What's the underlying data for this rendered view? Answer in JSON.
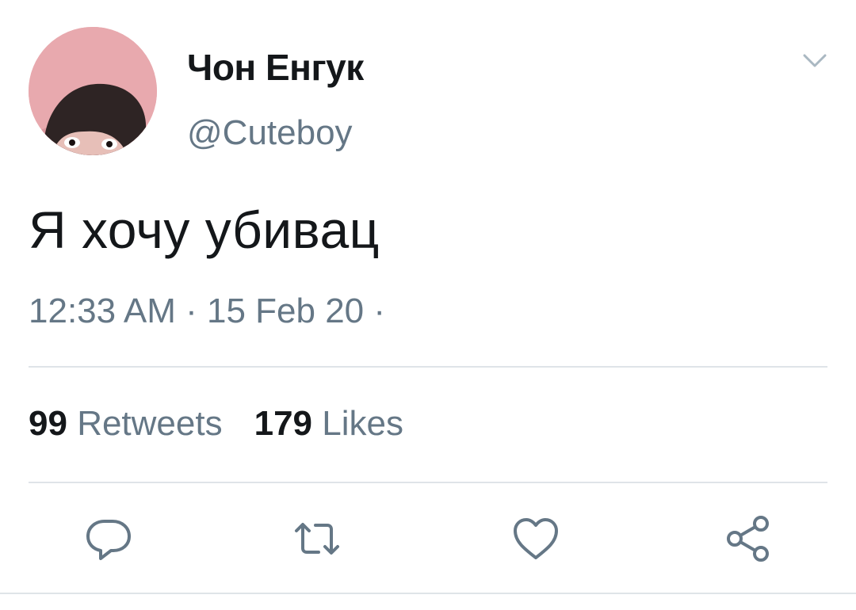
{
  "user": {
    "display_name": "Чон Енгук",
    "handle": "@Cuteboy",
    "avatar_icon": "profile-photo"
  },
  "tweet": {
    "text": "Я хочу убивац",
    "timestamp": "12:33 AM · 15 Feb 20 ·"
  },
  "stats": {
    "retweets_count": "99",
    "retweets_label": "Retweets",
    "likes_count": "179",
    "likes_label": "Likes"
  },
  "actions": {
    "reply_icon": "reply-icon",
    "retweet_icon": "retweet-icon",
    "like_icon": "heart-icon",
    "share_icon": "share-icon"
  },
  "colors": {
    "primary_text": "#14171a",
    "secondary_text": "#657786",
    "icon": "#657786",
    "divider": "#dfe4e8"
  }
}
